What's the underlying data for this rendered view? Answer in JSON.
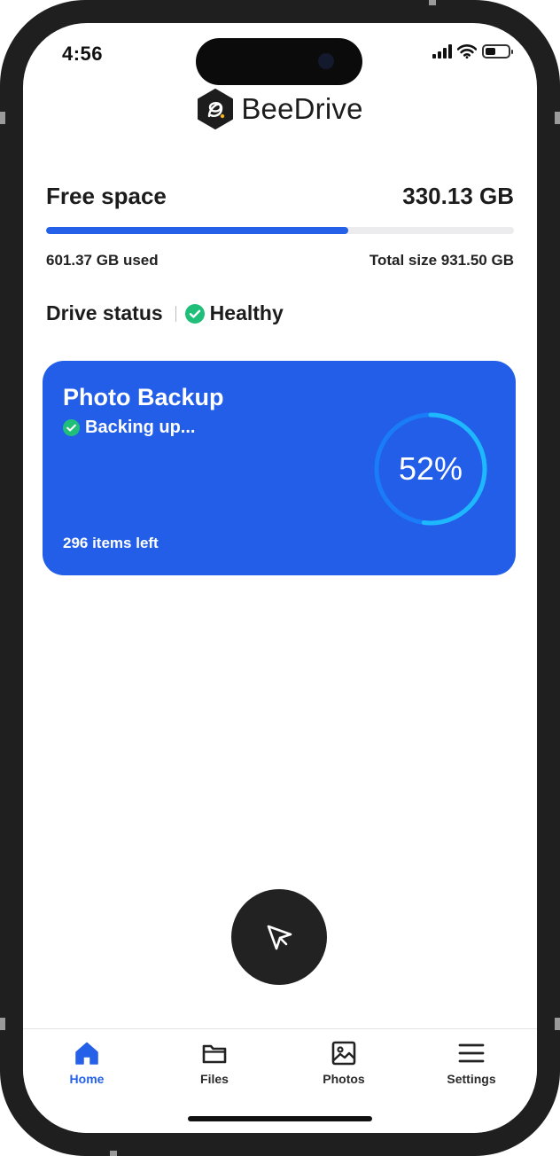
{
  "status_bar": {
    "time": "4:56"
  },
  "app": {
    "name": "BeeDrive"
  },
  "storage": {
    "free_label": "Free space",
    "free_value": "330.13 GB",
    "used_label": "601.37 GB used",
    "total_label": "Total size 931.50 GB",
    "used_fraction": 0.6456
  },
  "drive_status": {
    "label": "Drive status",
    "value": "Healthy"
  },
  "backup_card": {
    "title": "Photo Backup",
    "status": "Backing up...",
    "items_left": "296 items left",
    "progress_label": "52%",
    "progress_fraction": 0.52
  },
  "tabs": [
    {
      "label": "Home",
      "icon": "home-icon",
      "active": true
    },
    {
      "label": "Files",
      "icon": "folder-icon",
      "active": false
    },
    {
      "label": "Photos",
      "icon": "image-icon",
      "active": false
    },
    {
      "label": "Settings",
      "icon": "menu-icon",
      "active": false
    }
  ],
  "colors": {
    "accent": "#2460e8",
    "card": "#235ee8",
    "healthy": "#1fbf7a",
    "ring": "#1eb8ff",
    "fab": "#222222"
  }
}
